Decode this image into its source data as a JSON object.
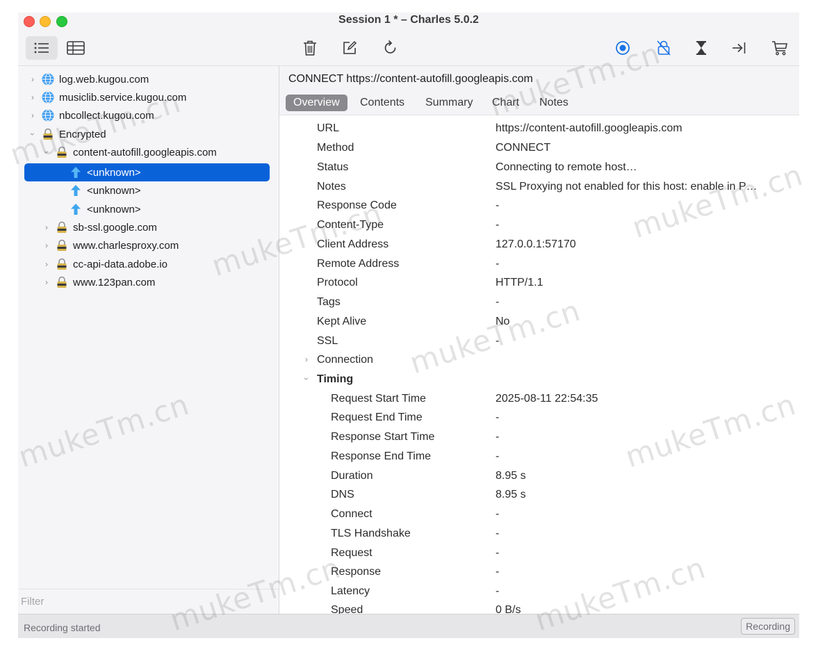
{
  "window": {
    "title": "Session 1 * – Charles 5.0.2"
  },
  "toolbar": {
    "left_buttons": [
      {
        "name": "list-view",
        "icon": "list-icon",
        "active": true
      },
      {
        "name": "table-view",
        "icon": "table-icon",
        "active": false
      }
    ],
    "center_buttons": [
      {
        "name": "clear",
        "icon": "trash-icon"
      },
      {
        "name": "edit",
        "icon": "edit-icon"
      },
      {
        "name": "repeat",
        "icon": "refresh-icon"
      }
    ],
    "right_buttons": [
      {
        "name": "record",
        "icon": "record-icon"
      },
      {
        "name": "ssl-proxying",
        "icon": "lock-slash-icon"
      },
      {
        "name": "throttle",
        "icon": "hourglass-icon"
      },
      {
        "name": "breakpoints",
        "icon": "arrow-to-line-icon"
      },
      {
        "name": "tools",
        "icon": "cart-icon"
      }
    ],
    "accent_color": "#1a73e8"
  },
  "tree": {
    "items": [
      {
        "label": "log.web.kugou.com",
        "icon": "globe-icon",
        "level": 0,
        "expanded": false
      },
      {
        "label": "musiclib.service.kugou.com",
        "icon": "globe-icon",
        "level": 0,
        "expanded": false
      },
      {
        "label": "nbcollect.kugou.com",
        "icon": "globe-icon",
        "level": 0,
        "expanded": false
      },
      {
        "label": "Encrypted",
        "icon": "lock-icon",
        "level": 0,
        "expanded": true
      },
      {
        "label": "content-autofill.googleapis.com",
        "icon": "lock-icon",
        "level": 1,
        "expanded": true
      },
      {
        "label": "<unknown>",
        "icon": "upload-arrow-icon",
        "level": 2,
        "selected": true
      },
      {
        "label": "<unknown>",
        "icon": "upload-arrow-icon",
        "level": 2
      },
      {
        "label": "<unknown>",
        "icon": "upload-arrow-icon",
        "level": 2
      },
      {
        "label": "sb-ssl.google.com",
        "icon": "lock-icon",
        "level": 1,
        "expanded": false
      },
      {
        "label": "www.charlesproxy.com",
        "icon": "lock-icon",
        "level": 1,
        "expanded": false
      },
      {
        "label": "cc-api-data.adobe.io",
        "icon": "lock-icon",
        "level": 1,
        "expanded": false
      },
      {
        "label": "www.123pan.com",
        "icon": "lock-icon",
        "level": 1,
        "expanded": false
      }
    ],
    "selection_color": "#0a62d9"
  },
  "filter": {
    "placeholder": "Filter"
  },
  "detail": {
    "request_title": "CONNECT https://content-autofill.googleapis.com",
    "tabs": [
      {
        "label": "Overview",
        "active": true
      },
      {
        "label": "Contents",
        "active": false
      },
      {
        "label": "Summary",
        "active": false
      },
      {
        "label": "Chart",
        "active": false
      },
      {
        "label": "Notes",
        "active": false
      }
    ],
    "properties": [
      {
        "label": "URL",
        "value": "https://content-autofill.googleapis.com"
      },
      {
        "label": "Method",
        "value": "CONNECT"
      },
      {
        "label": "Status",
        "value": "Connecting to remote host…"
      },
      {
        "label": "Notes",
        "value": "SSL Proxying not enabled for this host: enable in P…"
      },
      {
        "label": "Response Code",
        "value": "-"
      },
      {
        "label": "Content-Type",
        "value": "-"
      },
      {
        "label": "Client Address",
        "value": "127.0.0.1:57170"
      },
      {
        "label": "Remote Address",
        "value": "-"
      },
      {
        "label": "Protocol",
        "value": "HTTP/1.1"
      },
      {
        "label": "Tags",
        "value": "-"
      },
      {
        "label": "Kept Alive",
        "value": "No"
      },
      {
        "label": "SSL",
        "value": "-"
      }
    ],
    "sections": [
      {
        "label": "Connection",
        "expanded": false
      },
      {
        "label": "Timing",
        "expanded": true
      }
    ],
    "timing": [
      {
        "label": "Request Start Time",
        "value": "2025-08-11 22:54:35"
      },
      {
        "label": "Request End Time",
        "value": "-"
      },
      {
        "label": "Response Start Time",
        "value": "-"
      },
      {
        "label": "Response End Time",
        "value": "-"
      },
      {
        "label": "Duration",
        "value": "8.95 s"
      },
      {
        "label": "DNS",
        "value": "8.95 s"
      },
      {
        "label": "Connect",
        "value": "-"
      },
      {
        "label": "TLS Handshake",
        "value": "-"
      },
      {
        "label": "Request",
        "value": "-"
      },
      {
        "label": "Response",
        "value": "-"
      },
      {
        "label": "Latency",
        "value": "-"
      },
      {
        "label": "Speed",
        "value": "0 B/s"
      }
    ]
  },
  "statusbar": {
    "text": "Recording started",
    "recording_button": "Recording"
  },
  "watermark": {
    "text": "mukeTm.cn"
  }
}
